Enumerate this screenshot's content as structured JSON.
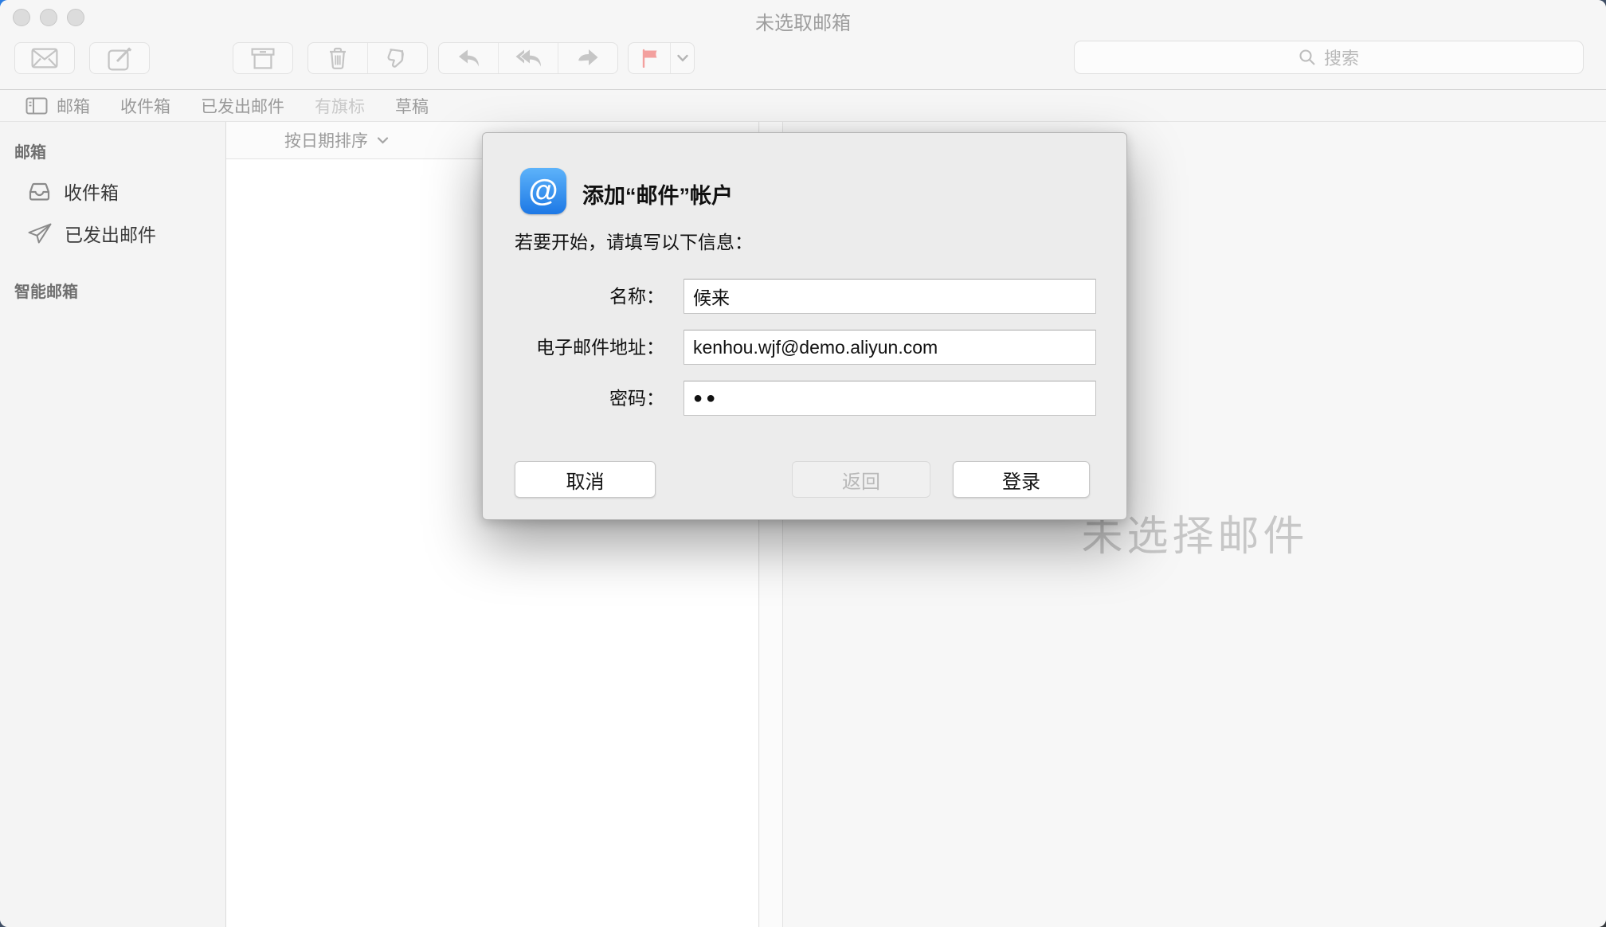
{
  "window": {
    "title": "未选取邮箱",
    "traffic_lights": [
      "close-button",
      "minimize-button",
      "zoom-button"
    ]
  },
  "toolbar": {
    "search": {
      "placeholder": "搜索",
      "icon": "search-icon"
    },
    "icons": [
      "envelope-icon",
      "compose-icon",
      "archive-icon",
      "trash-icon",
      "junk-thumbs-down-icon",
      "reply-icon",
      "reply-all-icon",
      "forward-icon",
      "flag-icon",
      "chevron-down-icon"
    ]
  },
  "favorites_bar": {
    "items": [
      {
        "label": "邮箱",
        "icon": "sidebar-panel-icon",
        "disabled": false
      },
      {
        "label": "收件箱",
        "disabled": false
      },
      {
        "label": "已发出邮件",
        "disabled": false
      },
      {
        "label": "有旗标",
        "disabled": true
      },
      {
        "label": "草稿",
        "disabled": false
      }
    ]
  },
  "sidebar": {
    "sections": [
      {
        "title": "邮箱",
        "items": [
          {
            "label": "收件箱",
            "icon": "inbox-icon"
          },
          {
            "label": "已发出邮件",
            "icon": "paper-plane-icon"
          }
        ]
      },
      {
        "title": "智能邮箱",
        "items": []
      }
    ]
  },
  "message_list": {
    "sort_label": "按日期排序",
    "sort_icon": "chevron-down-icon"
  },
  "content": {
    "empty_message": "未选择邮件"
  },
  "dialog": {
    "icon": "at-badge-icon",
    "icon_glyph": "@",
    "title": "添加“邮件”帐户",
    "subtitle": "若要开始，请填写以下信息：",
    "fields": [
      {
        "label": "名称：",
        "value": "候来"
      },
      {
        "label": "电子邮件地址：",
        "value": "kenhou.wjf@demo.aliyun.com"
      },
      {
        "label": "密码：",
        "value": "●●",
        "masked": true
      }
    ],
    "buttons": {
      "cancel": "取消",
      "back": "返回",
      "login": "登录"
    },
    "back_disabled": true
  },
  "colors": {
    "flag_pink": "#f3a09e",
    "at_icon_blue_top": "#5db3fa",
    "at_icon_blue_bottom": "#1d78e5",
    "dialog_bg": "#ececec",
    "watermark_gray": "#c7c7c7"
  }
}
